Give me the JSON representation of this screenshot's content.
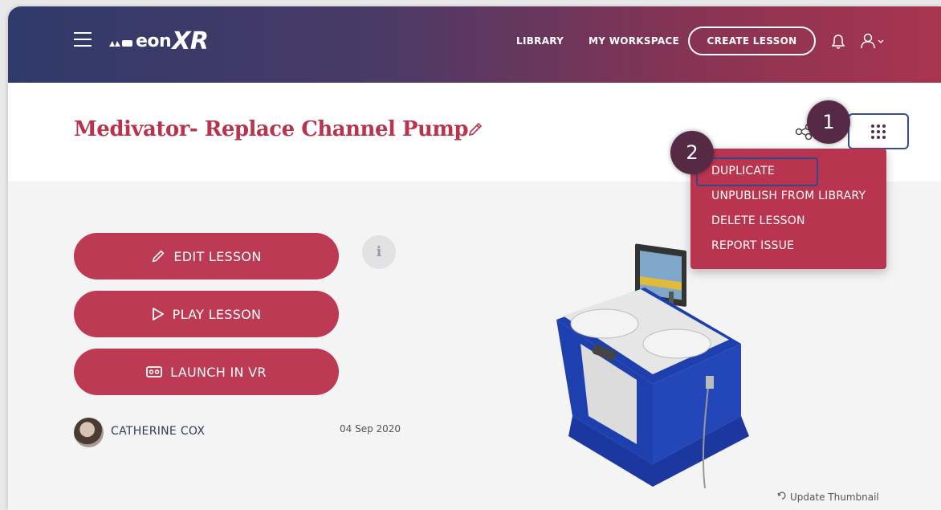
{
  "header": {
    "logo_text": "eon",
    "logo_xr": "XR",
    "nav": [
      "LIBRARY",
      "MY WORKSPACE"
    ],
    "create_label": "CREATE LESSON"
  },
  "lesson": {
    "title": "Medivator- Replace Channel Pump",
    "buttons": [
      "EDIT LESSON",
      "PLAY LESSON",
      "LAUNCH IN VR"
    ],
    "author": "CATHERINE COX",
    "date": "04 Sep 2020",
    "update_thumbnail": "Update Thumbnail"
  },
  "menu": {
    "items": [
      "DUPLICATE",
      "UNPUBLISH FROM LIBRARY",
      "DELETE LESSON",
      "REPORT ISSUE"
    ]
  },
  "callouts": [
    "1",
    "2"
  ],
  "info_glyph": "i",
  "colors": {
    "accent": "#bc3a53",
    "title": "#b8344d",
    "badge": "#562a45",
    "highlight": "#2f4a8a"
  }
}
